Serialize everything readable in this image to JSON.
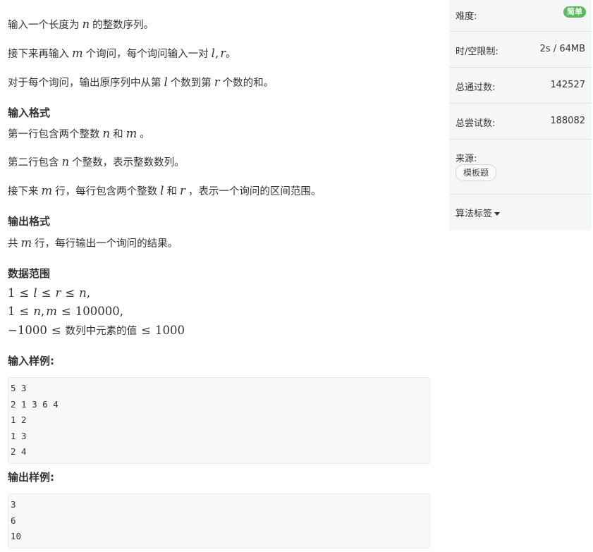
{
  "problem": {
    "desc1": {
      "pre": "输入一个长度为",
      "n": "n",
      "post": "的整数序列。"
    },
    "desc2": {
      "pre": "接下来再输入",
      "m": "m",
      "mid": "个询问，每个询问输入一对",
      "l": "l",
      "comma": ",",
      "r": "r",
      "post": "。"
    },
    "desc3": {
      "pre": "对于每个询问，输出原序列中从第",
      "l": "l",
      "mid": "个数到第",
      "r": "r",
      "post": "个数的和。"
    },
    "input_format_title": "输入格式",
    "in1": {
      "pre": "第一行包含两个整数",
      "n": "n",
      "mid": "和",
      "m": "m",
      "post": "。"
    },
    "in2": {
      "pre": "第二行包含",
      "n": "n",
      "post": "个整数，表示整数数列。"
    },
    "in3": {
      "pre": "接下来",
      "m": "m",
      "mid1": "行，每行包含两个整数",
      "l": "l",
      "mid2": "和",
      "r": "r",
      "post": "，表示一个询问的区间范围。"
    },
    "output_format_title": "输出格式",
    "out1": {
      "pre": "共",
      "m": "m",
      "post": "行，每行输出一个询问的结果。"
    },
    "range_title": "数据范围",
    "r1": {
      "a": "1",
      "le1": "≤",
      "b": "l",
      "le2": "≤",
      "c": "r",
      "le3": "≤",
      "d": "n",
      "end": ","
    },
    "r2": {
      "a": "1",
      "le1": "≤",
      "b": "n",
      "comma": ",",
      "c": "m",
      "le2": "≤",
      "d": "100000",
      "end": ","
    },
    "r3": {
      "a": "−1000",
      "le1": "≤",
      "text": "数列中元素的值",
      "le2": "≤",
      "d": "1000"
    },
    "sample_input_title": "输入样例:",
    "sample_input": [
      "5 3",
      "2 1 3 6 4",
      "1 2",
      "1 3",
      "2 4"
    ],
    "sample_output_title": "输出样例:",
    "sample_output": [
      "3",
      "6",
      "10"
    ]
  },
  "sidebar": {
    "difficulty_label": "难度:",
    "difficulty_value": "简单",
    "limit_label": "时/空限制:",
    "limit_value": "2s / 64MB",
    "passed_label": "总通过数:",
    "passed_value": "142527",
    "attempts_label": "总尝试数:",
    "attempts_value": "188082",
    "source_label": "来源:",
    "source_tag": "模板题",
    "algo_tags_label": "算法标签"
  },
  "colors": {
    "badge": "#5cb85c",
    "sidebar_bg": "#f5f6f7",
    "code_bg": "#f7f8f9"
  }
}
